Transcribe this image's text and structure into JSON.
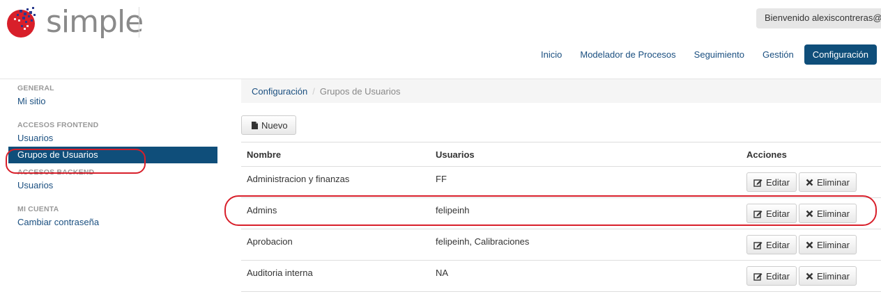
{
  "header": {
    "logo_text": "simple",
    "welcome_text": "Bienvenido alexiscontreras@",
    "nav": [
      {
        "label": "Inicio"
      },
      {
        "label": "Modelador de Procesos"
      },
      {
        "label": "Seguimiento"
      },
      {
        "label": "Gestión"
      },
      {
        "label": "Configuración",
        "active": true
      }
    ]
  },
  "sidebar": {
    "sections": [
      {
        "title": "GENERAL",
        "items": [
          "Mi sitio"
        ]
      },
      {
        "title": "ACCESOS FRONTEND",
        "items": [
          "Usuarios",
          "Grupos de Usuarios"
        ]
      },
      {
        "title": "ACCESOS BACKEND",
        "items": [
          "Usuarios"
        ]
      },
      {
        "title": "MI CUENTA",
        "items": [
          "Cambiar contraseña"
        ]
      }
    ],
    "active_item": "Grupos de Usuarios"
  },
  "breadcrumb": {
    "parent": "Configuración",
    "current": "Grupos de Usuarios"
  },
  "toolbar": {
    "new_label": "Nuevo",
    "new_icon": "file-icon"
  },
  "table": {
    "columns": [
      "Nombre",
      "Usuarios",
      "Acciones"
    ],
    "rows": [
      {
        "name": "Administracion y finanzas",
        "users": "FF"
      },
      {
        "name": "Admins",
        "users": "felipeinh"
      },
      {
        "name": "Aprobacion",
        "users": "felipeinh, Calibraciones"
      },
      {
        "name": "Auditoria interna",
        "users": "NA"
      }
    ],
    "edit_label": "Editar",
    "delete_label": "Eliminar"
  },
  "colors": {
    "accent": "#0f4e7a",
    "link": "#1a4f80",
    "annotation": "#d81f2a",
    "logo_red": "#d81f2a"
  }
}
